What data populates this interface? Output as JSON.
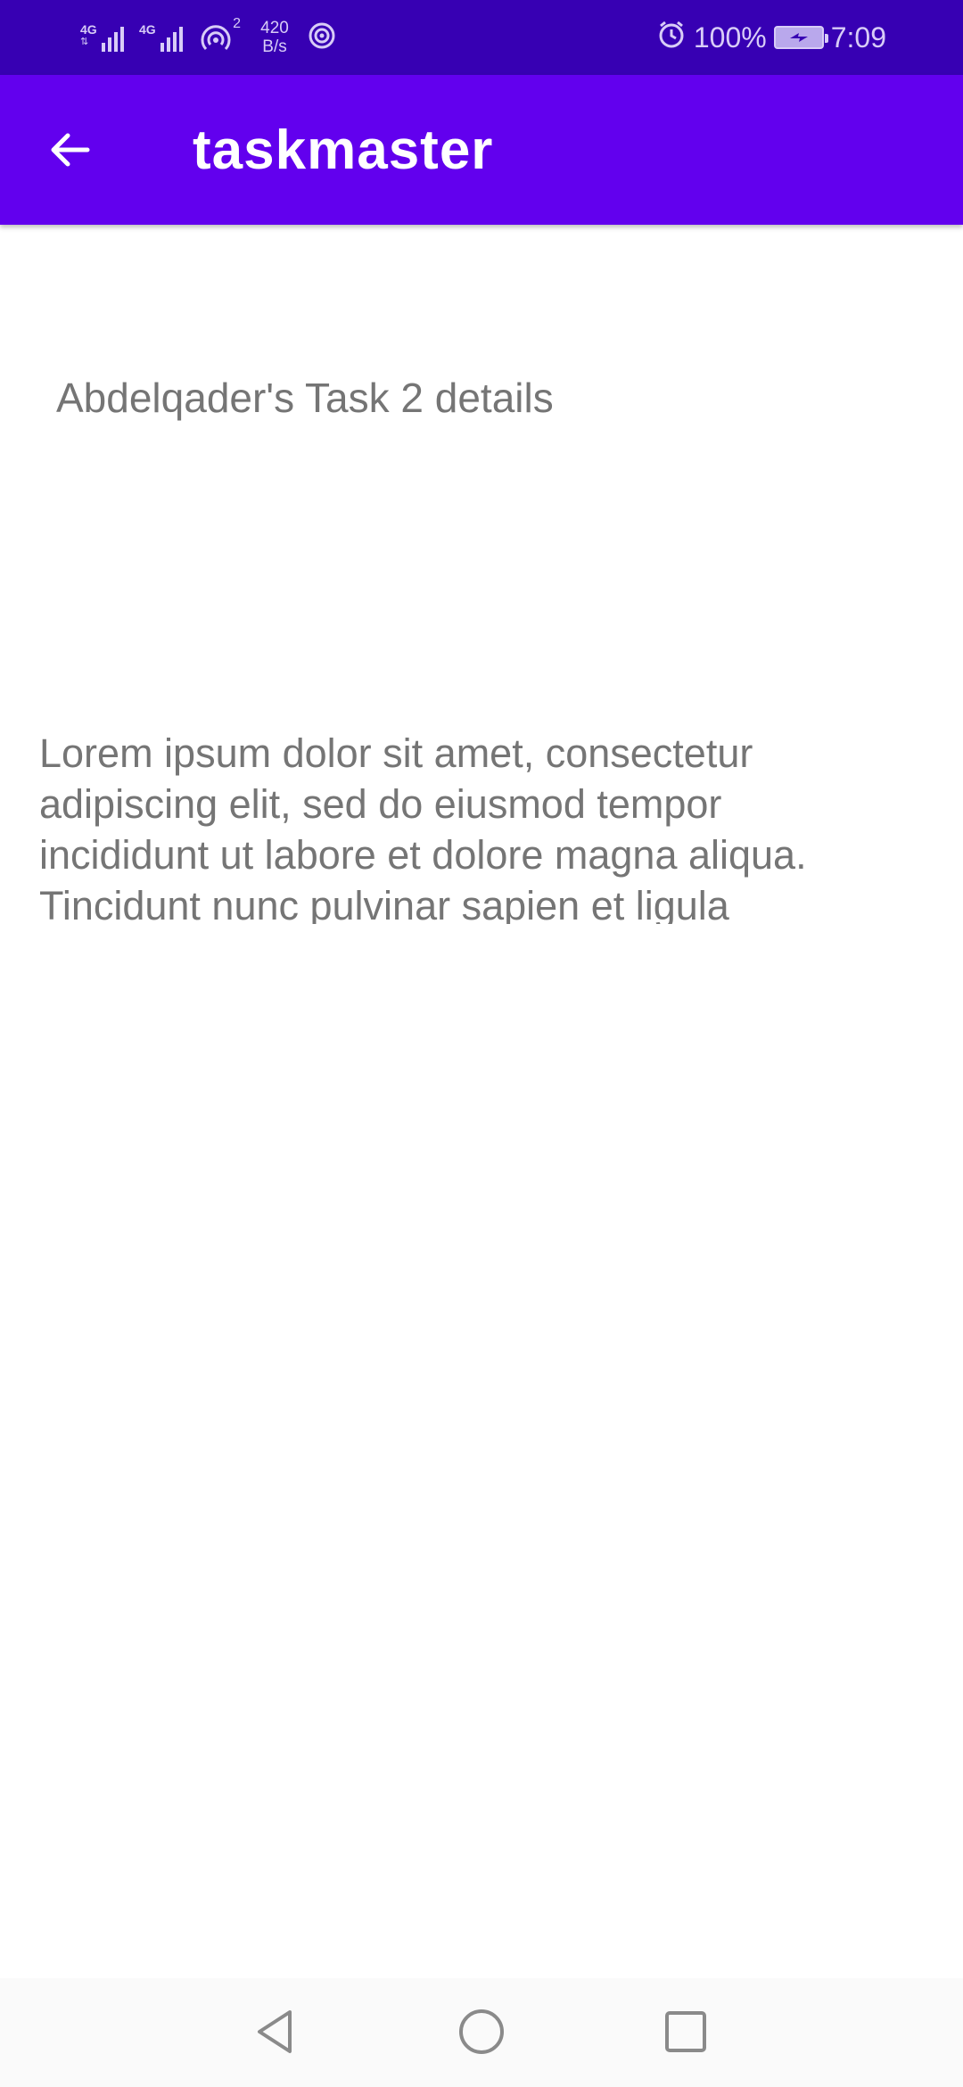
{
  "status_bar": {
    "network_1": "4G",
    "network_2": "4G",
    "hotspot_count": "2",
    "speed_value": "420",
    "speed_unit": "B/s",
    "battery_level": "100%",
    "time": "7:09",
    "icons": [
      "signal-icon",
      "signal-icon",
      "hotspot-icon",
      "nfc-icon",
      "alarm-icon",
      "battery-charging-icon"
    ],
    "color": "#3700b3"
  },
  "app_bar": {
    "title": "taskmaster",
    "color": "#6200ee",
    "back_icon": "arrow-back-icon"
  },
  "task": {
    "title": "Abdelqader's Task 2 details",
    "body": "Lorem ipsum dolor sit amet, consectetur adipiscing elit, sed do eiusmod tempor incididunt ut labore et dolore magna aliqua. Tincidunt nunc pulvinar sapien et ligula"
  },
  "nav_bar": {
    "buttons": [
      "back-triangle-icon",
      "home-circle-icon",
      "recents-square-icon"
    ]
  }
}
